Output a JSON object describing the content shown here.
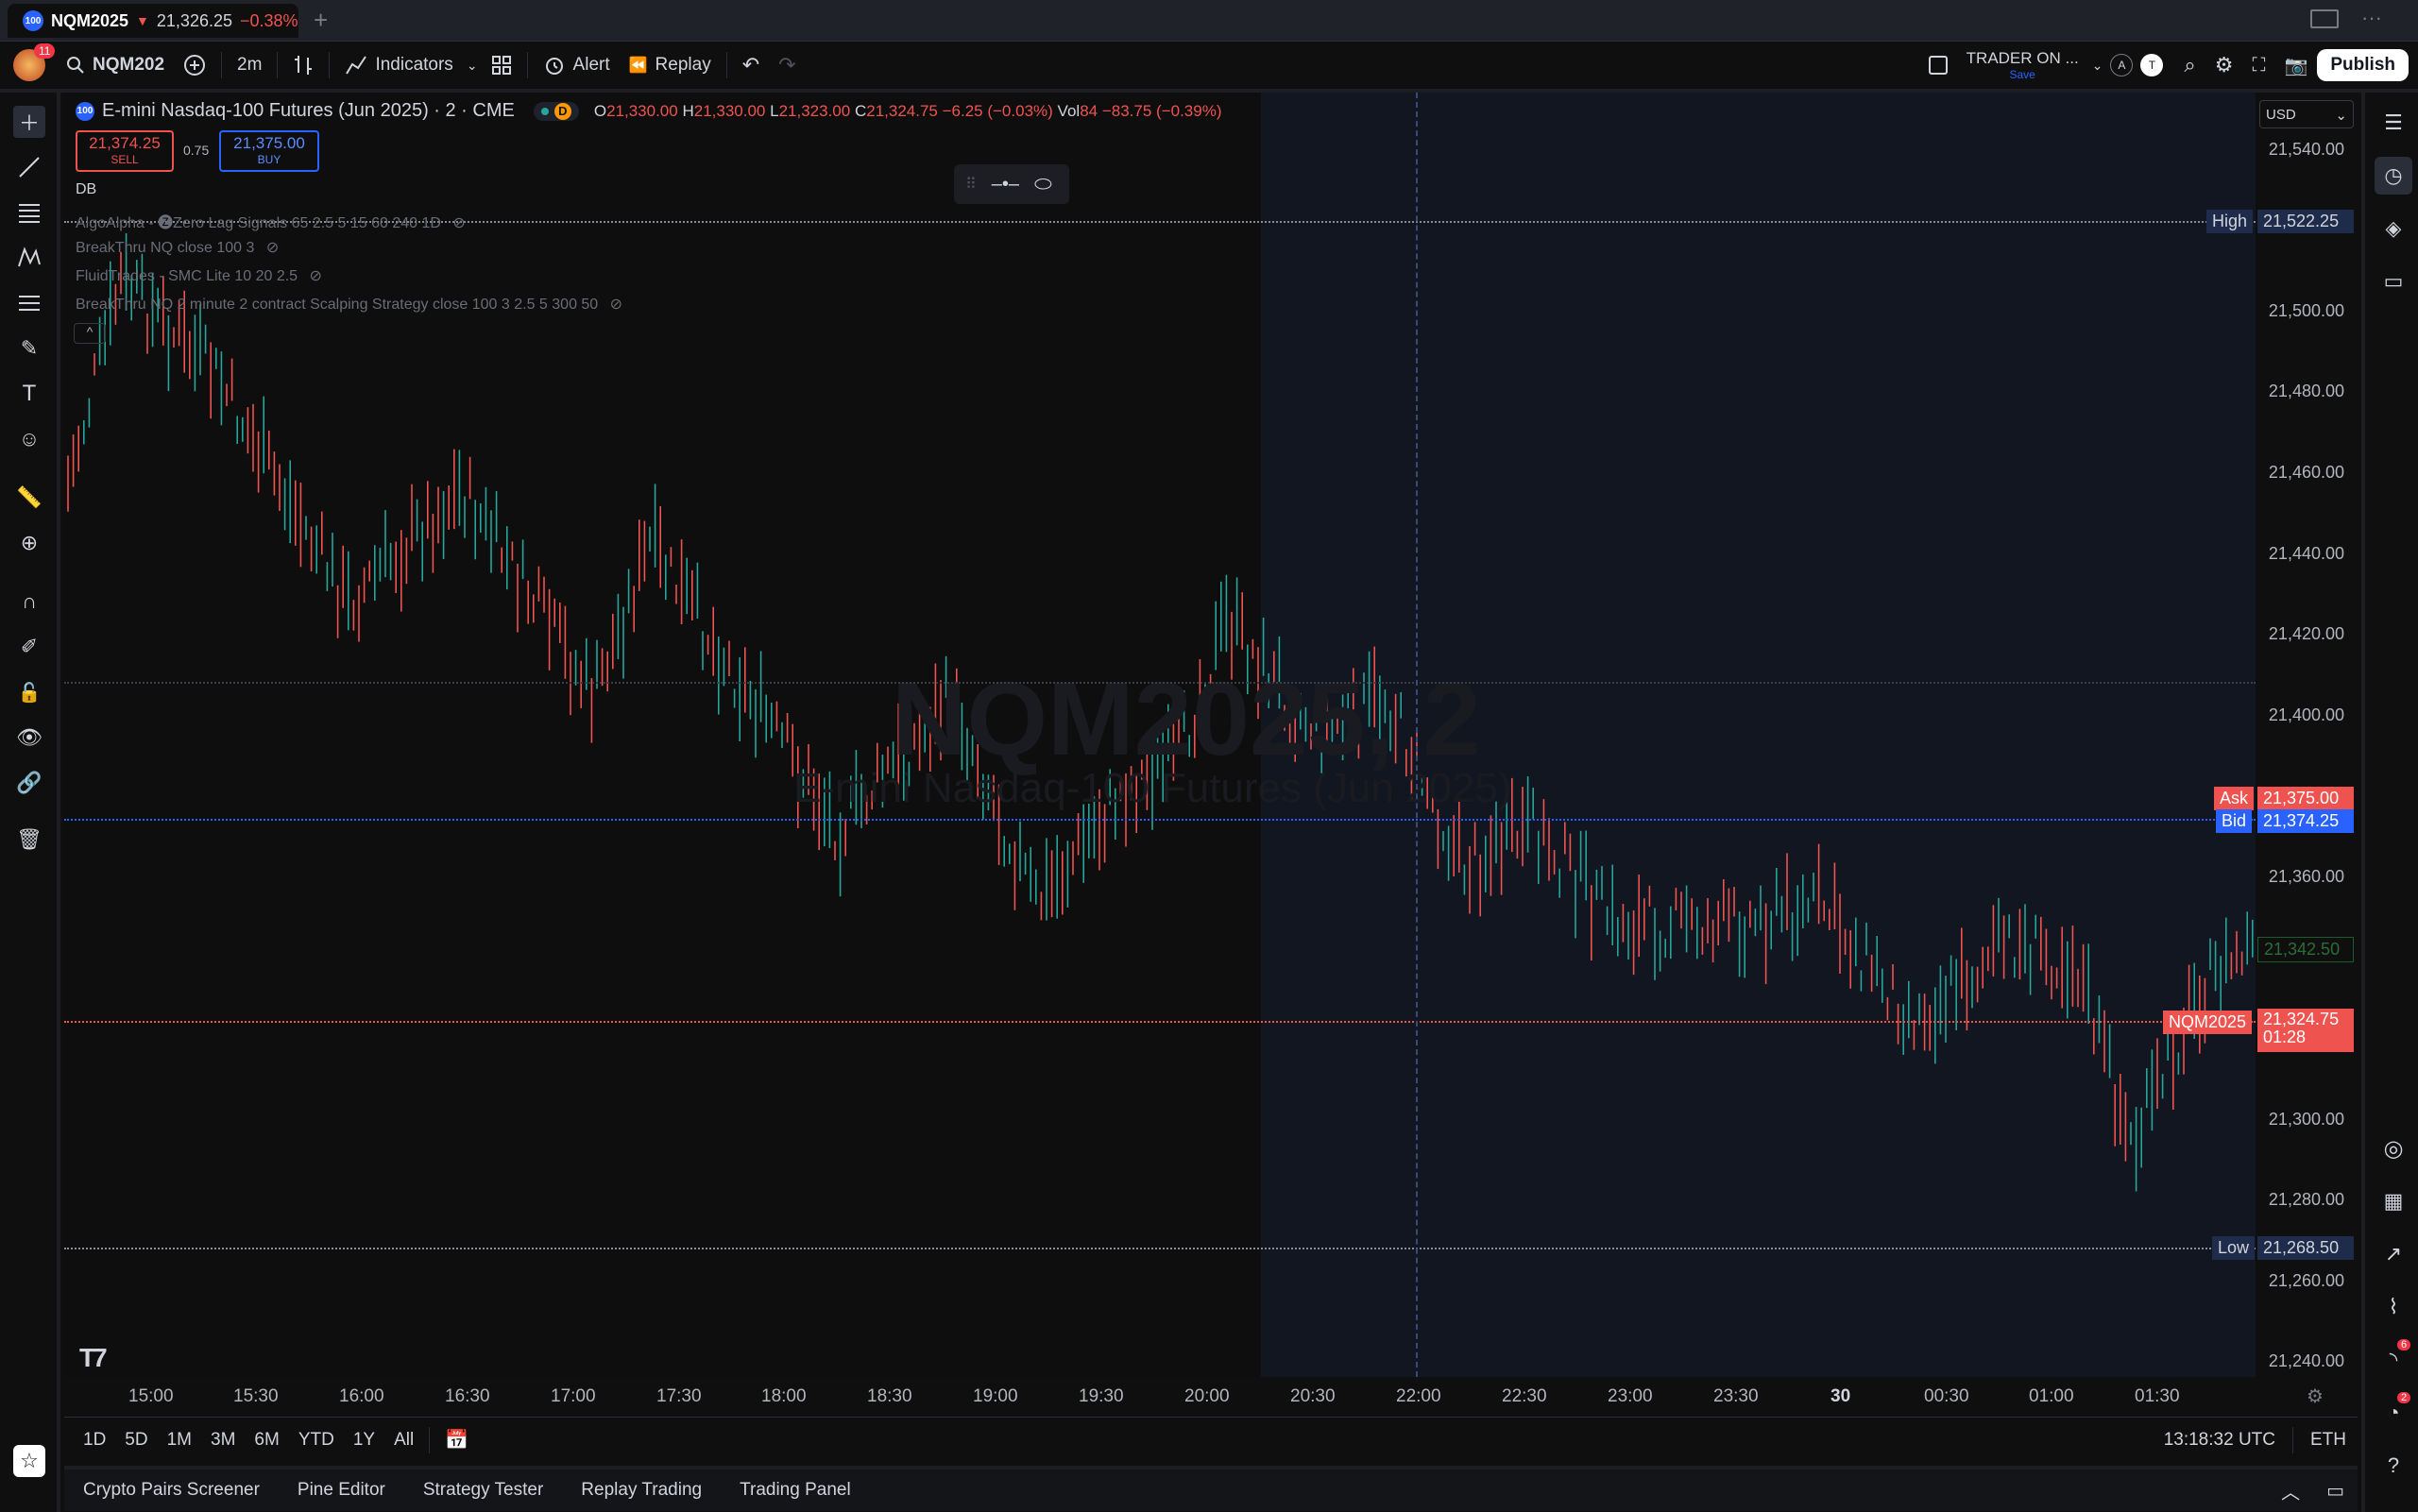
{
  "tab": {
    "symbol": "NQM2025",
    "price": "21,326.25",
    "change": "−0.38%",
    "arrow": "▼",
    "icon_text": "100"
  },
  "toolbar": {
    "notif_count": "11",
    "symbol": "NQM202",
    "interval": "2m",
    "indicators": "Indicators",
    "alert": "Alert",
    "replay": "Replay",
    "layout_name": "TRADER ON ...",
    "layout_sub": "Save",
    "avatar_a": "A",
    "avatar_t": "T",
    "publish": "Publish"
  },
  "legend": {
    "title": "E-mini Nasdaq-100 Futures (Jun 2025) · 2 · CME",
    "o_label": "O",
    "o": "21,330.00",
    "h_label": "H",
    "h": "21,330.00",
    "l_label": "L",
    "l": "21,323.00",
    "c_label": "C",
    "c": "21,324.75",
    "chg": "−6.25 (−0.03%)",
    "vol_label": "Vol",
    "vol": "84",
    "volchg": "−83.75 (−0.39%)",
    "sell_price": "21,374.25",
    "sell_label": "SELL",
    "spread": "0.75",
    "buy_price": "21,375.00",
    "buy_label": "BUY",
    "db": "DB",
    "d_badge": "D"
  },
  "indicators": [
    "AlgoAlpha - 🅩Zero Lag Signals 65 2.5 5 15 60 240 1D",
    "BreakThru NQ close 100 3",
    "FluidTrades - SMC Lite 10 20 2.5",
    "BreakThru NQ 2 minute 2 contract Scalping Strategy close 100 3 2.5 5 300 50"
  ],
  "watermark": {
    "symbol": "NQM2025, 2",
    "name": "E-mini Nasdaq-100 Futures (Jun 2025)"
  },
  "scale": {
    "currency": "USD",
    "labels": [
      "21,540.00",
      "21,500.00",
      "21,480.00",
      "21,460.00",
      "21,440.00",
      "21,420.00",
      "21,400.00",
      "21,360.00",
      "21,300.00",
      "21,280.00",
      "21,260.00",
      "21,240.00"
    ]
  },
  "tags": {
    "high_label": "High",
    "high": "21,522.25",
    "ask_label": "Ask",
    "ask": "21,375.00",
    "bid_label": "Bid",
    "bid": "21,374.25",
    "other": "21,342.50",
    "sym_label": "NQM2025",
    "last": "21,324.75",
    "countdown": "01:28",
    "low_label": "Low",
    "low": "21,268.50"
  },
  "time_axis": [
    "15:00",
    "15:30",
    "16:00",
    "16:30",
    "17:00",
    "17:30",
    "18:00",
    "18:30",
    "19:00",
    "19:30",
    "20:00",
    "20:30",
    "22:00",
    "22:30",
    "23:00",
    "23:30",
    "30",
    "00:30",
    "01:00",
    "01:30"
  ],
  "ranges": [
    "1D",
    "5D",
    "1M",
    "3M",
    "6M",
    "YTD",
    "1Y",
    "All"
  ],
  "clock": "13:18:32 UTC",
  "session": "ETH",
  "panels": [
    "Crypto Pairs Screener",
    "Pine Editor",
    "Strategy Tester",
    "Replay Trading",
    "Trading Panel"
  ],
  "right_badges": {
    "rss": "6",
    "alerts": "2"
  },
  "colors": {
    "up": "#26a69a",
    "down": "#ef5350",
    "accent": "#2962ff",
    "bg": "#0f0f0f"
  }
}
